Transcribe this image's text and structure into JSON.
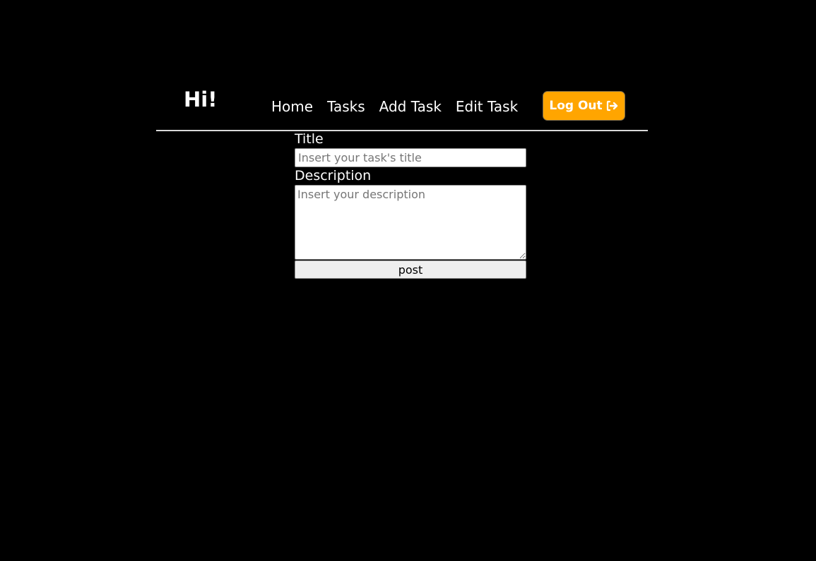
{
  "header": {
    "greeting": "Hi!",
    "nav": [
      {
        "label": "Home"
      },
      {
        "label": "Tasks"
      },
      {
        "label": "Add Task"
      },
      {
        "label": "Edit Task"
      }
    ],
    "logout": {
      "label": "Log Out",
      "icon": "sign-out-icon",
      "color": "#ffa500"
    }
  },
  "form": {
    "title_label": "Title",
    "title_placeholder": "Insert your task's title",
    "title_value": "",
    "description_label": "Description",
    "description_placeholder": "Insert your description",
    "description_value": "",
    "submit_label": "post"
  }
}
